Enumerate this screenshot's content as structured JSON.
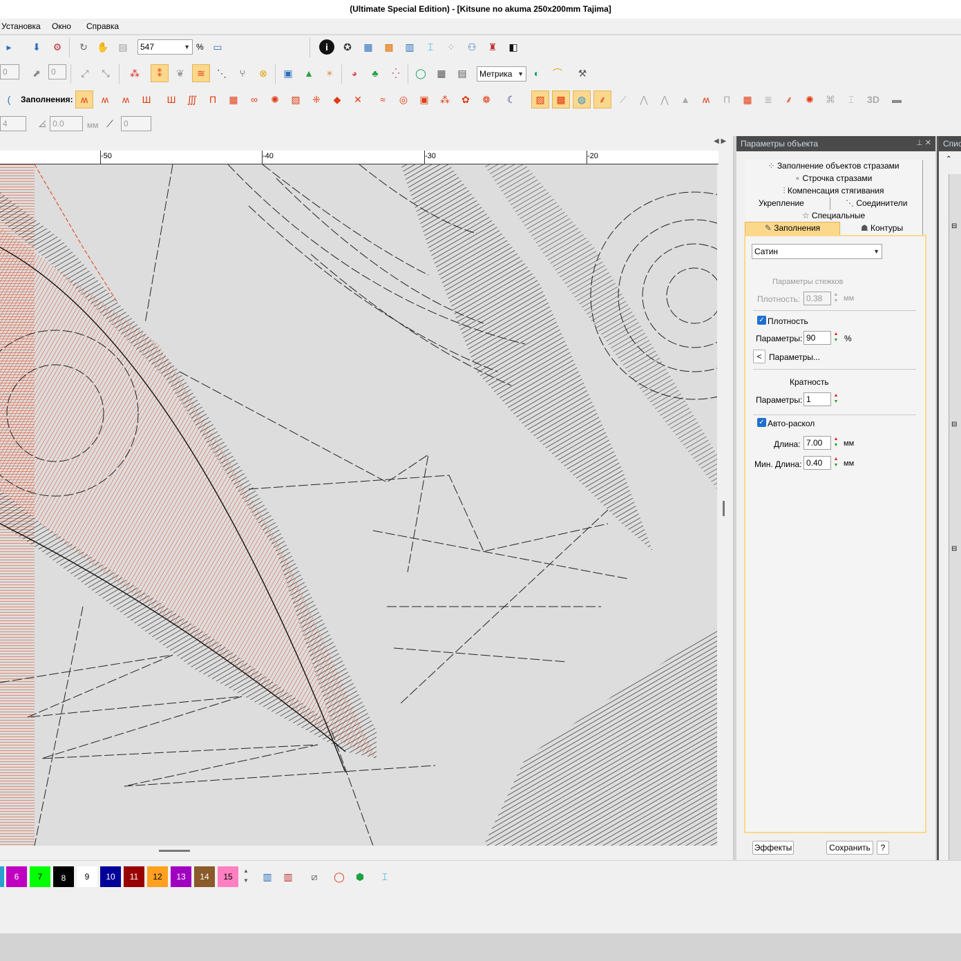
{
  "window": {
    "title": "(Ultimate Special Edition) - [Kitsune no akuma 250x200mm        Tajima]"
  },
  "menu": {
    "items": [
      "Установка",
      "Окно",
      "Справка"
    ]
  },
  "toolbar1": {
    "zoom_value": "547",
    "zoom_unit": "%"
  },
  "toolbar2": {
    "left_value": "0",
    "rotate_value": "0",
    "units_select": "Метрика"
  },
  "toolbar3": {
    "fills_label": "Заполнения:",
    "threed_label": "3D"
  },
  "toolbar4": {
    "val1": "4",
    "val2": "0.0",
    "unit": "мм",
    "val3": "0"
  },
  "ruler": {
    "ticks": [
      "-50",
      "-40",
      "-30",
      "-20"
    ]
  },
  "panel": {
    "title": "Параметры объекта",
    "tabs": {
      "rhinestone_fill": "Заполнение объектов стразами",
      "rhinestone_line": "Строчка стразами",
      "pull_comp": "Компенсация стягивания",
      "underlay": "Укрепление",
      "connectors": "Соединители",
      "special": "Специальные",
      "fills": "Заполнения",
      "outlines": "Контуры"
    },
    "fill_type": "Сатин",
    "stitch_params_label": "Параметры стежков",
    "density_label": "Плотность:",
    "density_value": "0.38",
    "mm": "мм",
    "density_check_label": "Плотность",
    "params_label": "Параметры:",
    "params_value": "90",
    "percent": "%",
    "params_button": "Параметры...",
    "params_button_arrow": "<",
    "multiplicity_label": "Кратность",
    "mult_params_label": "Параметры:",
    "mult_value": "1",
    "autosplit_label": "Авто-раскол",
    "length_label": "Длина:",
    "length_value": "7.00",
    "minlength_label": "Мин. Длина:",
    "minlength_value": "0.40",
    "effects_button": "Эффекты",
    "save_button": "Сохранить",
    "help_button": "?"
  },
  "right_panel": {
    "title": "Спис"
  },
  "palette": {
    "swatches": [
      {
        "num": "6",
        "color": "#c000c0"
      },
      {
        "num": "7",
        "color": "#00ff00"
      },
      {
        "num": "8",
        "color": "#000000"
      },
      {
        "num": "9",
        "color": "#ffffff"
      },
      {
        "num": "10",
        "color": "#000099"
      },
      {
        "num": "11",
        "color": "#990000"
      },
      {
        "num": "12",
        "color": "#ffa020"
      },
      {
        "num": "13",
        "color": "#a000c0"
      },
      {
        "num": "14",
        "color": "#8a5a2a"
      },
      {
        "num": "15",
        "color": "#ff80c0"
      }
    ]
  }
}
